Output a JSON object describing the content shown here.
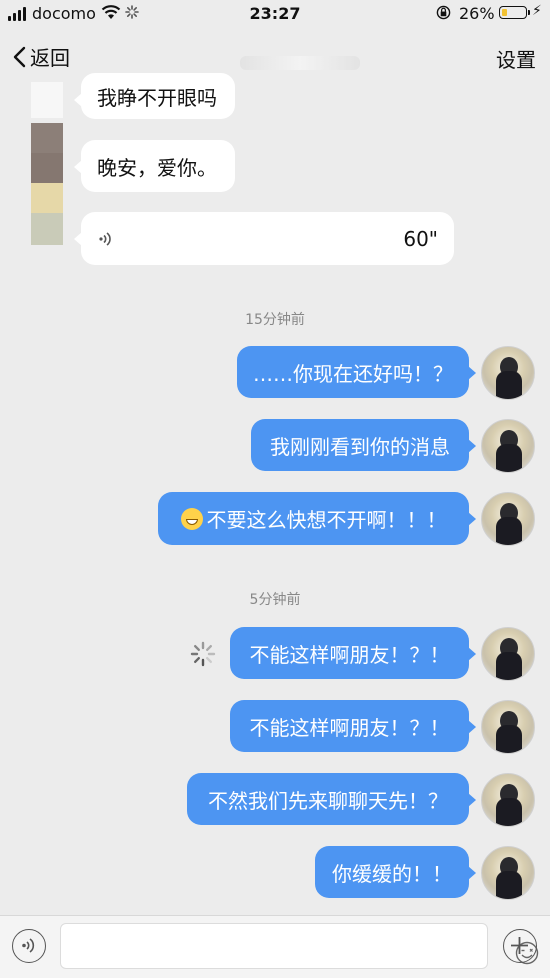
{
  "status_bar": {
    "carrier": "docomo",
    "time": "23:27",
    "battery_percent": "26%",
    "battery_level": 0.26
  },
  "nav": {
    "back_label": "返回",
    "settings_label": "设置"
  },
  "received": {
    "message_1": "我睁不开眼吗",
    "message_2": "晚安，爱你。",
    "voice_duration": "60\""
  },
  "timestamps": [
    "15分钟前",
    "5分钟前"
  ],
  "sent": [
    "……你现在还好吗！？",
    "我刚刚看到你的消息",
    "不要这么快想不开啊！！！",
    "不能这样啊朋友！？！",
    "不能这样啊朋友！？！",
    "不然我们先来聊聊天先！？",
    "你缓缓的！！"
  ],
  "colors": {
    "sent_bubble": "#4d95f2",
    "received_bubble": "#ffffff",
    "background": "#ececec"
  },
  "icons": {
    "emoji_in_message": "grinning-sweat-emoji",
    "sending_indicator": "loading-spinner-icon"
  }
}
